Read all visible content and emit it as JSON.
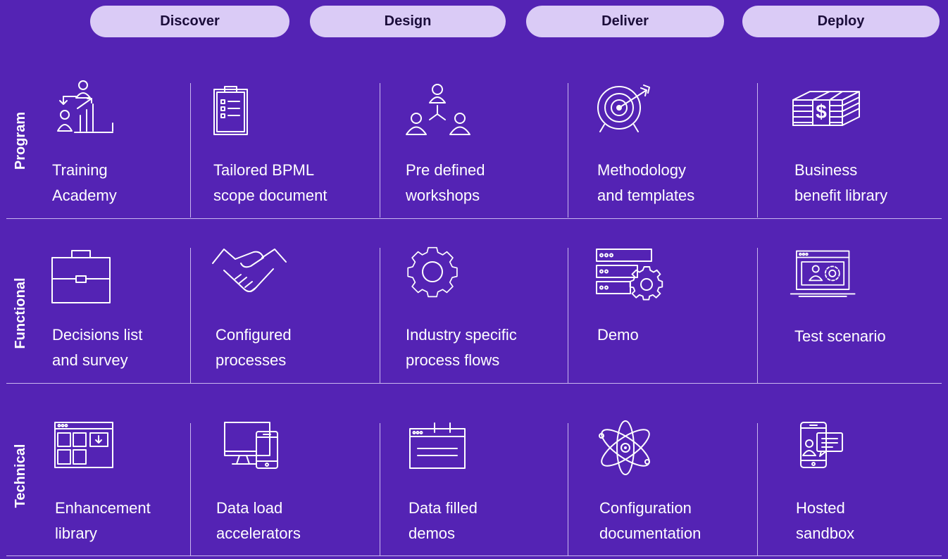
{
  "phases": [
    "Discover",
    "Design",
    "Deliver",
    "Deploy"
  ],
  "rows": [
    {
      "label": "Program",
      "items": [
        {
          "icon": "training-hierarchy-icon",
          "text": "Training\nAcademy"
        },
        {
          "icon": "clipboard-checklist-icon",
          "text": "Tailored BPML\nscope document"
        },
        {
          "icon": "people-network-icon",
          "text": "Pre defined\nworkshops"
        },
        {
          "icon": "target-arrow-icon",
          "text": "Methodology\nand templates"
        },
        {
          "icon": "money-stack-icon",
          "text": "Business\nbenefit library"
        }
      ]
    },
    {
      "label": "Functional",
      "items": [
        {
          "icon": "briefcase-icon",
          "text": "Decisions list\nand survey"
        },
        {
          "icon": "handshake-icon",
          "text": "Configured\nprocesses"
        },
        {
          "icon": "gear-icon",
          "text": "Industry specific\nprocess flows"
        },
        {
          "icon": "server-gear-icon",
          "text": "Demo"
        },
        {
          "icon": "laptop-user-gear-icon",
          "text": "Test scenario"
        }
      ]
    },
    {
      "label": "Technical",
      "items": [
        {
          "icon": "app-window-grid-icon",
          "text": "Enhancement\nlibrary"
        },
        {
          "icon": "devices-icon",
          "text": "Data load\naccelerators"
        },
        {
          "icon": "calendar-icon",
          "text": "Data filled\ndemos"
        },
        {
          "icon": "atom-icon",
          "text": "Configuration\ndocumentation"
        },
        {
          "icon": "mobile-chat-icon",
          "text": "Hosted\nsandbox"
        }
      ]
    }
  ]
}
